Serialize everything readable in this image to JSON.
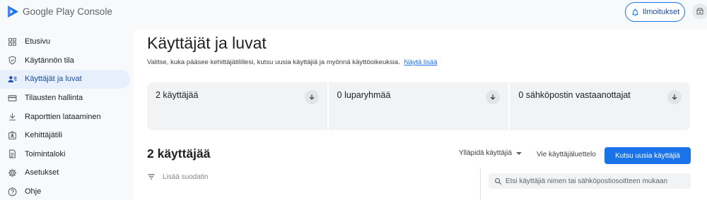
{
  "app": {
    "name": "Google Play Console"
  },
  "header": {
    "notifications_label": "Ilmoitukset"
  },
  "sidebar": {
    "items": [
      {
        "label": "Etusivu",
        "icon": "dashboard-icon"
      },
      {
        "label": "Käytännön tila",
        "icon": "shield-icon"
      },
      {
        "label": "Käyttäjät ja luvat",
        "icon": "users-icon",
        "active": true
      },
      {
        "label": "Tilausten hallinta",
        "icon": "credit-card-icon"
      },
      {
        "label": "Raporttien lataaminen",
        "icon": "download-icon"
      },
      {
        "label": "Kehittäjätili",
        "icon": "account-box-icon"
      },
      {
        "label": "Toimintaloki",
        "icon": "document-icon"
      },
      {
        "label": "Asetukset",
        "icon": "gear-icon"
      },
      {
        "label": "Ohje",
        "icon": "help-icon"
      }
    ]
  },
  "main": {
    "title": "Käyttäjät ja luvat",
    "description": "Valitse, kuka pääsee kehittäjätilillesi, kutsu uusia käyttäjiä ja myönnä käyttöoikeuksia.",
    "learn_more": "Näytä lisää",
    "stats": [
      {
        "label": "2 käyttäjää"
      },
      {
        "label": "0 luparyhmää"
      },
      {
        "label": "0 sähköpostin vastaanottajat"
      }
    ],
    "section_title": "2 käyttäjää",
    "maintain_label": "Ylläpidä käyttäjiä",
    "export_label": "Vie käyttäjäluettelo",
    "invite_label": "Kutsu uusia käyttäjiä",
    "filter_label": "Lisää suodatin",
    "search_placeholder": "Etsi käyttäjiä nimen tai sähköpostiosoitteen mukaan"
  },
  "colors": {
    "accent": "#1a73e8",
    "active_nav_bg": "#e8f0fe"
  }
}
